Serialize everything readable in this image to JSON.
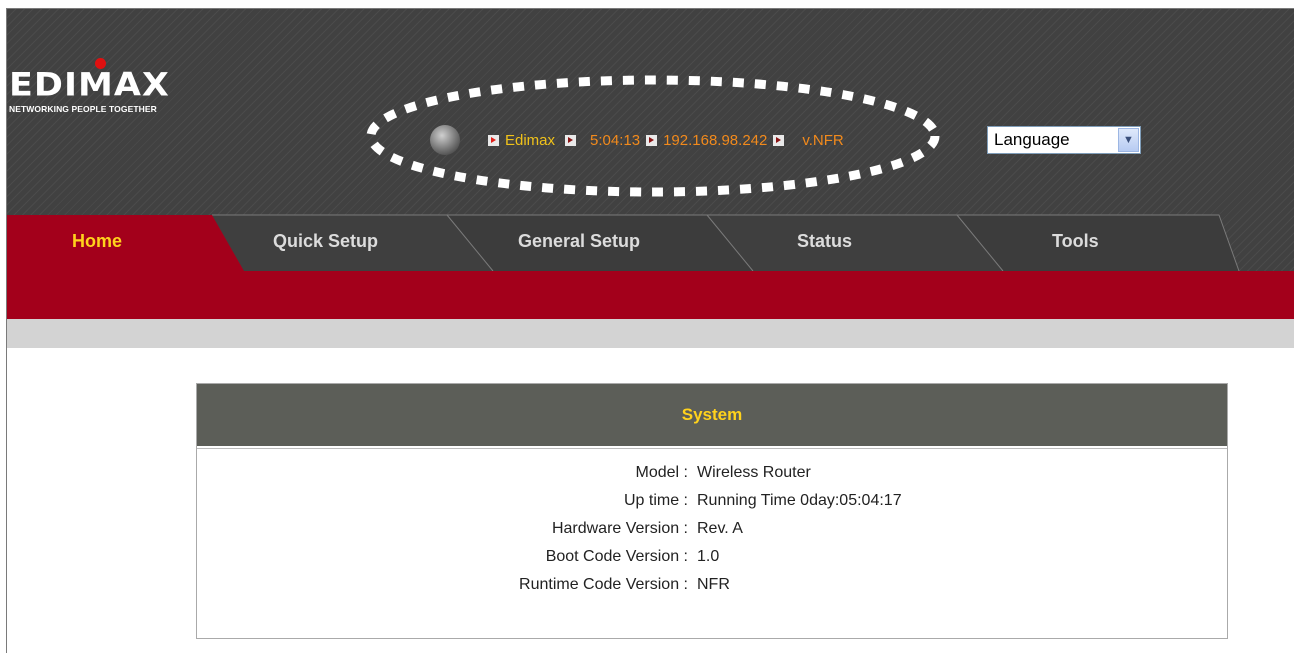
{
  "logo": {
    "name": "EDIMAX",
    "tagline": "NETWORKING PEOPLE TOGETHER"
  },
  "status": {
    "device_name": "Edimax",
    "time": "5:04:13",
    "ip": "192.168.98.242",
    "version": "v.NFR"
  },
  "language_select": {
    "selected": "Language"
  },
  "tabs": [
    {
      "label": "Home",
      "active": true
    },
    {
      "label": "Quick Setup",
      "active": false
    },
    {
      "label": "General Setup",
      "active": false
    },
    {
      "label": "Status",
      "active": false
    },
    {
      "label": "Tools",
      "active": false
    }
  ],
  "system": {
    "title": "System",
    "rows": [
      {
        "key": "Model :",
        "value": "Wireless Router"
      },
      {
        "key": "Up time :",
        "value": "Running Time 0day:05:04:17"
      },
      {
        "key": "Hardware Version :",
        "value": "Rev. A"
      },
      {
        "key": "Boot Code Version :",
        "value": "1.0"
      },
      {
        "key": "Runtime Code Version :",
        "value": "NFR"
      }
    ]
  },
  "colors": {
    "accent_red": "#a3001b",
    "tab_gold": "#ffd21c",
    "header_dark": "#414141",
    "status_orange": "#f28a1c"
  }
}
